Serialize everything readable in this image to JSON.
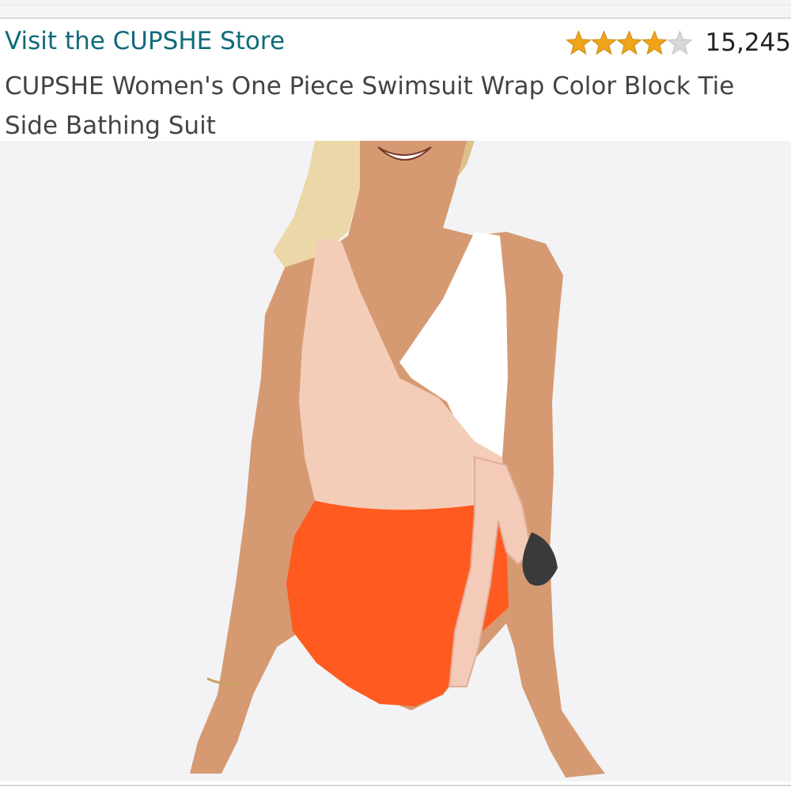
{
  "store": {
    "link_text": "Visit the CUPSHE Store"
  },
  "rating": {
    "stars": 4,
    "max_stars": 5,
    "review_count": "15,245",
    "star_color": "#f0a41a",
    "empty_star_color": "#d8d8d8"
  },
  "product": {
    "title": "CUPSHE Women's One Piece Swimsuit Wrap Color Block Tie Side Bathing Suit",
    "image": {
      "top_color": "#f3cdb8",
      "panel_color": "#ffffff",
      "bottom_color": "#ff5a1f"
    }
  },
  "colors": {
    "link": "#0f6b7a",
    "title": "#444444"
  }
}
